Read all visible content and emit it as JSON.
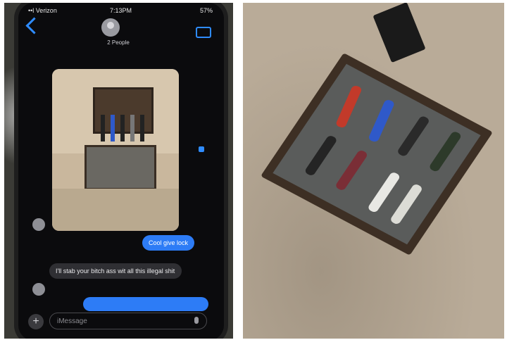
{
  "left_photo": {
    "status_bar": {
      "carrier": "••l Verizon",
      "clock": "7:13PM",
      "battery": "57%"
    },
    "contact": {
      "name": "2 People"
    },
    "messages": {
      "sent_1": "Cool give lock",
      "received": "I'll stab your bitch ass wit all this illegal shit",
      "sent_2": ""
    },
    "compose": {
      "placeholder": "iMessage"
    },
    "icons": [
      "back-icon",
      "contact-avatar",
      "video-call-icon",
      "plus-icon",
      "mic-icon"
    ]
  },
  "right_photo": {
    "scene": "knife-display-case-on-carpet"
  }
}
